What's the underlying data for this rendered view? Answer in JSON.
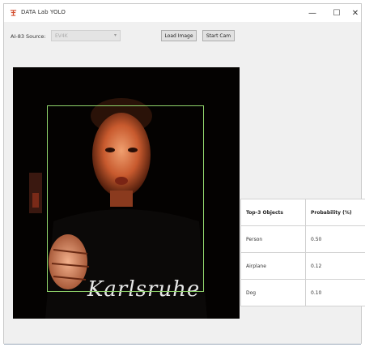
{
  "window": {
    "title": "DATA Lab YOLO",
    "controls": {
      "minimize": "—",
      "maximize": "☐",
      "close": "✕"
    }
  },
  "toolbar": {
    "source_label": "AI-83 Source:",
    "source_value": "EV4K",
    "load_button": "Load Image",
    "start_button": "Start Cam"
  },
  "image": {
    "shirt_text": "Karlsruhe",
    "detection_box_color": "#8fd36a"
  },
  "results": {
    "headers": [
      "Top-3 Objects",
      "Probability (%)"
    ],
    "rows": [
      {
        "object": "Person",
        "probability": "0.50"
      },
      {
        "object": "Airplane",
        "probability": "0.12"
      },
      {
        "object": "Dog",
        "probability": "0.10"
      }
    ]
  }
}
